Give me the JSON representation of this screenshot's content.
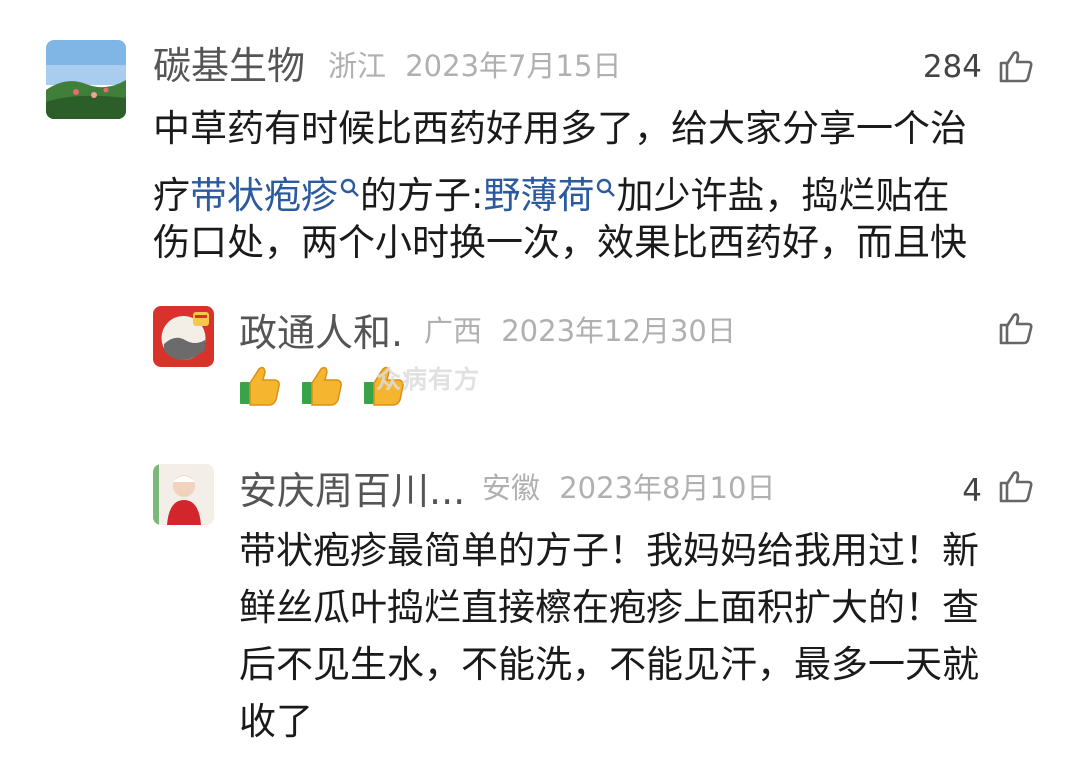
{
  "colors": {
    "link": "#2c5a9e",
    "meta": "#b0b0b0",
    "name": "#555555",
    "text": "#1a1a1a"
  },
  "watermark": "众病有方",
  "comments": [
    {
      "user": "碳基生物",
      "location": "浙江",
      "date": "2023年7月15日",
      "likes": "284",
      "lines": [
        {
          "segments": [
            {
              "text": "中草药有时候比西药好用多了，给大家分享一个治"
            }
          ]
        },
        {
          "segments": [
            {
              "text": "疗"
            },
            {
              "text": "带状疱疹",
              "link": true
            },
            {
              "text": "的方子:"
            },
            {
              "text": "野薄荷",
              "link": true
            },
            {
              "text": "加少许盐，捣烂贴在"
            }
          ]
        },
        {
          "segments": [
            {
              "text": "伤口处，两个小时换一次，效果比西药好，而且快"
            }
          ]
        }
      ]
    },
    {
      "user": "政通人和.",
      "location": "广西",
      "date": "2023年12月30日",
      "likes": "",
      "emoji": [
        "thumbs-up",
        "thumbs-up",
        "thumbs-up"
      ]
    },
    {
      "user": "安庆周百川...",
      "location": "安徽",
      "date": "2023年8月10日",
      "likes": "4",
      "lines": [
        {
          "segments": [
            {
              "text": "带状疱疹最简单的方子！我妈妈给我用过！新"
            }
          ]
        },
        {
          "segments": [
            {
              "text": "鲜丝瓜叶捣烂直接檫在疱疹上面积扩大的！查"
            }
          ]
        },
        {
          "segments": [
            {
              "text": "后不见生水，不能洗，不能见汗，最多一天就"
            }
          ]
        },
        {
          "segments": [
            {
              "text": "收了"
            }
          ]
        }
      ]
    }
  ]
}
